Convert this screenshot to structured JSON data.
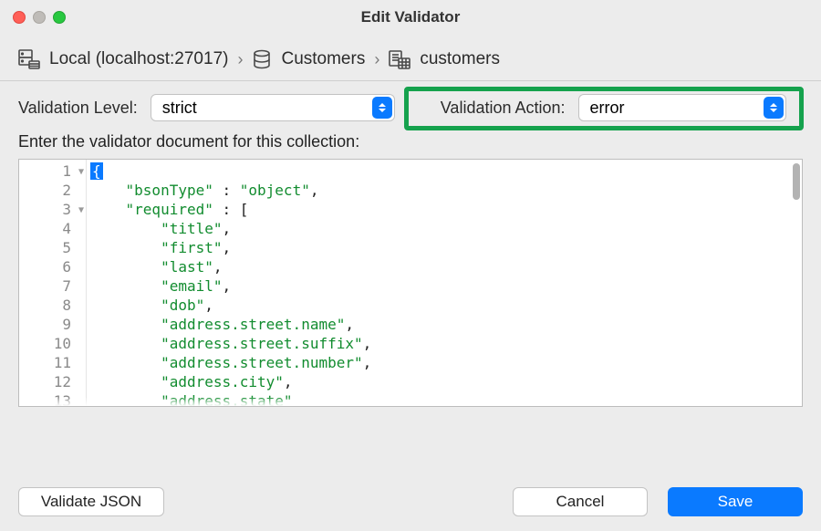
{
  "window": {
    "title": "Edit Validator"
  },
  "breadcrumb": {
    "connection": "Local (localhost:27017)",
    "database": "Customers",
    "collection": "customers"
  },
  "controls": {
    "level_label": "Validation Level:",
    "level_value": "strict",
    "action_label": "Validation Action:",
    "action_value": "error"
  },
  "editor": {
    "instruction": "Enter the validator document for this collection:",
    "tokens": {
      "bsonType_key": "\"bsonType\"",
      "bsonType_val": "\"object\"",
      "required_key": "\"required\""
    },
    "required": [
      "\"title\"",
      "\"first\"",
      "\"last\"",
      "\"email\"",
      "\"dob\"",
      "\"address.street.name\"",
      "\"address.street.suffix\"",
      "\"address.street.number\"",
      "\"address.city\"",
      "\"address.state\""
    ]
  },
  "footer": {
    "validate": "Validate JSON",
    "cancel": "Cancel",
    "save": "Save"
  }
}
